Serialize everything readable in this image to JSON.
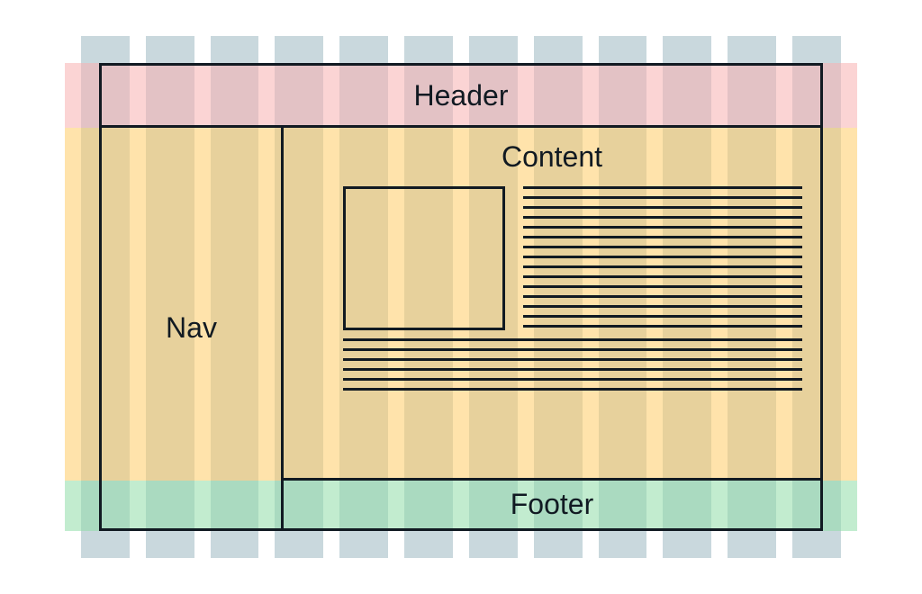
{
  "layout": {
    "header": {
      "label": "Header"
    },
    "nav": {
      "label": "Nav"
    },
    "content": {
      "label": "Content"
    },
    "footer": {
      "label": "Footer"
    }
  },
  "diagram": {
    "columns": 12,
    "rows": [
      "header",
      "middle",
      "footer"
    ],
    "colors": {
      "column_stripe": "#c9d8dd",
      "header_row": "#f7b1b1",
      "middle_row": "#ffcc66",
      "footer_row": "#90dca8",
      "border": "#111a22"
    }
  }
}
